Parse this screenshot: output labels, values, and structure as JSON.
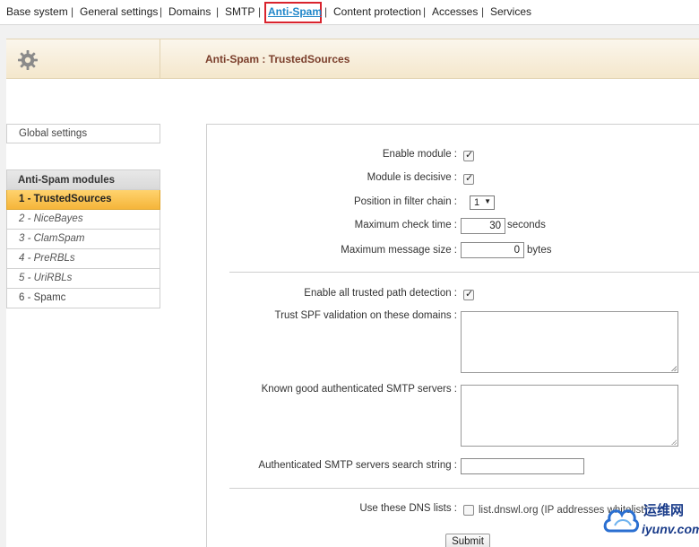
{
  "nav": {
    "items": [
      "Base system",
      "General settings",
      "Domains",
      "SMTP",
      "Anti-Spam",
      "Content protection",
      "Accesses",
      "Services"
    ],
    "active_index": 4,
    "separator": "|"
  },
  "header": {
    "title": "Anti-Spam : TrustedSources",
    "icon": "gear-icon"
  },
  "sidebar": {
    "global_settings": "Global settings",
    "modules_heading": "Anti-Spam modules",
    "modules": [
      "1 - TrustedSources",
      "2 - NiceBayes",
      "3 - ClamSpam",
      "4 - PreRBLs",
      "5 - UriRBLs",
      "6 - Spamc"
    ],
    "active_module_index": 0
  },
  "form": {
    "enable_module": {
      "label": "Enable module :",
      "checked": true
    },
    "module_decisive": {
      "label": "Module is decisive :",
      "checked": true
    },
    "position": {
      "label": "Position in filter chain :",
      "value": "1"
    },
    "max_check_time": {
      "label": "Maximum check time :",
      "value": "30",
      "unit": "seconds"
    },
    "max_message_size": {
      "label": "Maximum message size :",
      "value": "0",
      "unit": "bytes"
    },
    "trusted_path": {
      "label": "Enable all trusted path detection :",
      "checked": true
    },
    "spf_domains": {
      "label": "Trust SPF validation on these domains :",
      "value": ""
    },
    "smtp_servers": {
      "label": "Known good authenticated SMTP servers :",
      "value": ""
    },
    "smtp_search": {
      "label": "Authenticated SMTP servers search string :",
      "value": ""
    },
    "dns_lists": {
      "label": "Use these DNS lists :",
      "option": "list.dnswl.org (IP addresses whitelist)",
      "checked": false
    },
    "submit_label": "Submit"
  },
  "watermark": {
    "line1": "运维网",
    "line2": "iyunv.com"
  }
}
